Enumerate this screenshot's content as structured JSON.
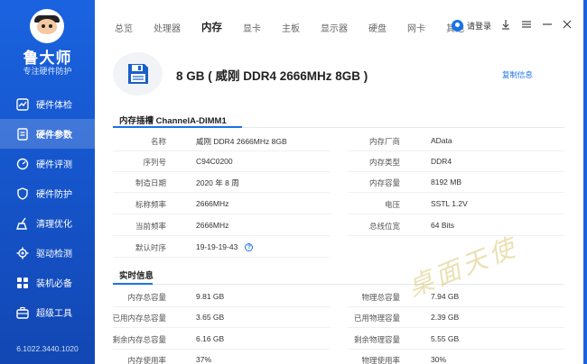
{
  "app": {
    "brand": "鲁大师",
    "slogan": "专注硬件防护",
    "version": "6.1022.3440.1020"
  },
  "sidebar": {
    "items": [
      {
        "label": "硬件体检",
        "icon": "chart-icon",
        "active": false
      },
      {
        "label": "硬件参数",
        "icon": "document-icon",
        "active": true
      },
      {
        "label": "硬件评测",
        "icon": "gauge-icon",
        "active": false
      },
      {
        "label": "硬件防护",
        "icon": "shield-icon",
        "active": false
      },
      {
        "label": "清理优化",
        "icon": "broom-icon",
        "active": false
      },
      {
        "label": "驱动检测",
        "icon": "gear-icon",
        "active": false
      },
      {
        "label": "装机必备",
        "icon": "apps-icon",
        "active": false
      },
      {
        "label": "超级工具",
        "icon": "toolbox-icon",
        "active": false
      }
    ]
  },
  "tabs": [
    {
      "label": "总览",
      "active": false
    },
    {
      "label": "处理器",
      "active": false
    },
    {
      "label": "内存",
      "active": true
    },
    {
      "label": "显卡",
      "active": false
    },
    {
      "label": "主板",
      "active": false
    },
    {
      "label": "显示器",
      "active": false
    },
    {
      "label": "硬盘",
      "active": false
    },
    {
      "label": "网卡",
      "active": false
    },
    {
      "label": "其他",
      "active": false
    }
  ],
  "header": {
    "login_label": "请登录"
  },
  "device": {
    "title": "8 GB ( 威刚 DDR4 2666MHz 8GB )",
    "copy_label": "复制信息"
  },
  "slot": {
    "title": "内存插槽 ChannelA-DIMM1",
    "left": [
      {
        "label": "名称",
        "value": "威刚 DDR4 2666MHz 8GB"
      },
      {
        "label": "序列号",
        "value": "C94C0200"
      },
      {
        "label": "制造日期",
        "value": "2020 年 8 周"
      },
      {
        "label": "标称频率",
        "value": "2666MHz"
      },
      {
        "label": "当前频率",
        "value": "2666MHz"
      },
      {
        "label": "默认时序",
        "value": "19-19-19-43"
      }
    ],
    "right": [
      {
        "label": "内存厂商",
        "value": "AData"
      },
      {
        "label": "内存类型",
        "value": "DDR4"
      },
      {
        "label": "内存容量",
        "value": "8192 MB"
      },
      {
        "label": "电压",
        "value": "SSTL 1.2V"
      },
      {
        "label": "总线位宽",
        "value": "64 Bits"
      }
    ]
  },
  "realtime": {
    "title": "实时信息",
    "left": [
      {
        "label": "内存总容量",
        "value": "9.81 GB"
      },
      {
        "label": "已用内存总容量",
        "value": "3.65 GB"
      },
      {
        "label": "剩余内存总容量",
        "value": "6.16 GB"
      },
      {
        "label": "内存使用率",
        "value": "37%"
      }
    ],
    "right": [
      {
        "label": "物理总容量",
        "value": "7.94 GB"
      },
      {
        "label": "已用物理容量",
        "value": "2.39 GB"
      },
      {
        "label": "剩余物理容量",
        "value": "5.55 GB"
      },
      {
        "label": "物理使用率",
        "value": "30%"
      }
    ]
  },
  "watermark": "桌面天使"
}
